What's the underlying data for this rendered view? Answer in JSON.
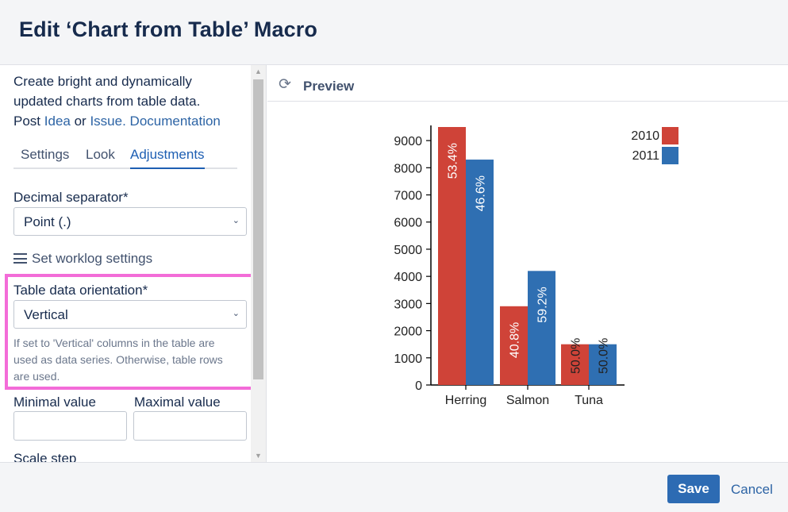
{
  "dialog": {
    "title": "Edit ‘Chart from Table’ Macro"
  },
  "intro": {
    "line1": "Create bright and dynamically updated charts from table data.",
    "post": "Post",
    "idea_link": "Idea",
    "or": "or",
    "issue_link": "Issue.",
    "doc_link": "Documentation"
  },
  "tabs": [
    {
      "label": "Settings",
      "active": false
    },
    {
      "label": "Look",
      "active": false
    },
    {
      "label": "Adjustments",
      "active": true
    }
  ],
  "decimal_separator": {
    "label": "Decimal separator*",
    "value": "Point (.)"
  },
  "worklog": {
    "label": "Set worklog settings"
  },
  "orientation": {
    "label": "Table data orientation*",
    "value": "Vertical",
    "help": "If set to 'Vertical' columns in the table are used as data series. Otherwise, table rows are used."
  },
  "min_value": {
    "label": "Minimal value",
    "value": ""
  },
  "max_value": {
    "label": "Maximal value",
    "value": ""
  },
  "scale_step": {
    "label": "Scale step"
  },
  "preview": {
    "title": "Preview"
  },
  "chart_data": {
    "type": "bar",
    "categories": [
      "Herring",
      "Salmon",
      "Tuna"
    ],
    "series": [
      {
        "name": "2010",
        "color": "#cf4338",
        "values": [
          9500,
          2900,
          1500
        ],
        "labels": [
          "53.4%",
          "40.8%",
          "50.0%"
        ]
      },
      {
        "name": "2011",
        "color": "#2f6fb2",
        "values": [
          8300,
          4200,
          1500
        ],
        "labels": [
          "46.6%",
          "59.2%",
          "50.0%"
        ]
      }
    ],
    "yticks": [
      0,
      1000,
      2000,
      3000,
      4000,
      5000,
      6000,
      7000,
      8000,
      9000
    ],
    "ylim": [
      0,
      9500
    ],
    "legend": "top-right"
  },
  "footer": {
    "save": "Save",
    "cancel": "Cancel"
  }
}
